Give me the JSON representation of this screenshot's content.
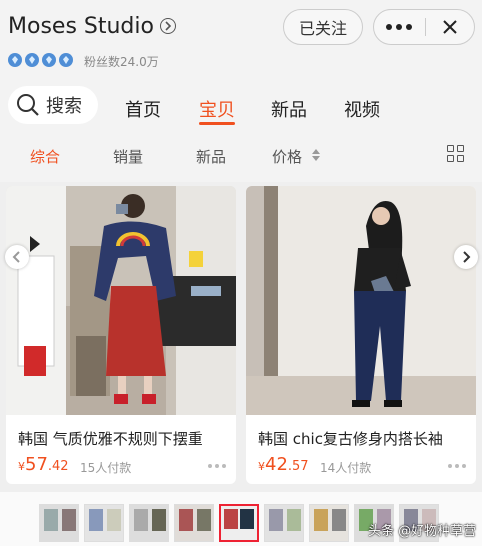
{
  "header": {
    "store_name": "Moses Studio",
    "follow_label": "已关注",
    "fans": "粉丝数24.0万"
  },
  "search": {
    "label": "搜索"
  },
  "tabs": [
    {
      "label": "首页"
    },
    {
      "label": "宝贝"
    },
    {
      "label": "新品"
    },
    {
      "label": "视频"
    }
  ],
  "active_tab": "宝贝",
  "sort": [
    {
      "label": "综合"
    },
    {
      "label": "销量"
    },
    {
      "label": "新品"
    },
    {
      "label": "价格"
    }
  ],
  "products": [
    {
      "title": "韩国 气质优雅不规则下摆重",
      "currency": "¥",
      "price_int": "57",
      "price_dec": ".42",
      "paid": "15人付款"
    },
    {
      "title": "韩国 chic复古修身内搭长袖",
      "currency": "¥",
      "price_int": "42",
      "price_dec": ".57",
      "paid": "14人付款"
    }
  ],
  "watermark": "头条 @好物种草营",
  "colors": {
    "accent": "#f0501f",
    "background": "#efefef"
  },
  "rating_count": 4
}
